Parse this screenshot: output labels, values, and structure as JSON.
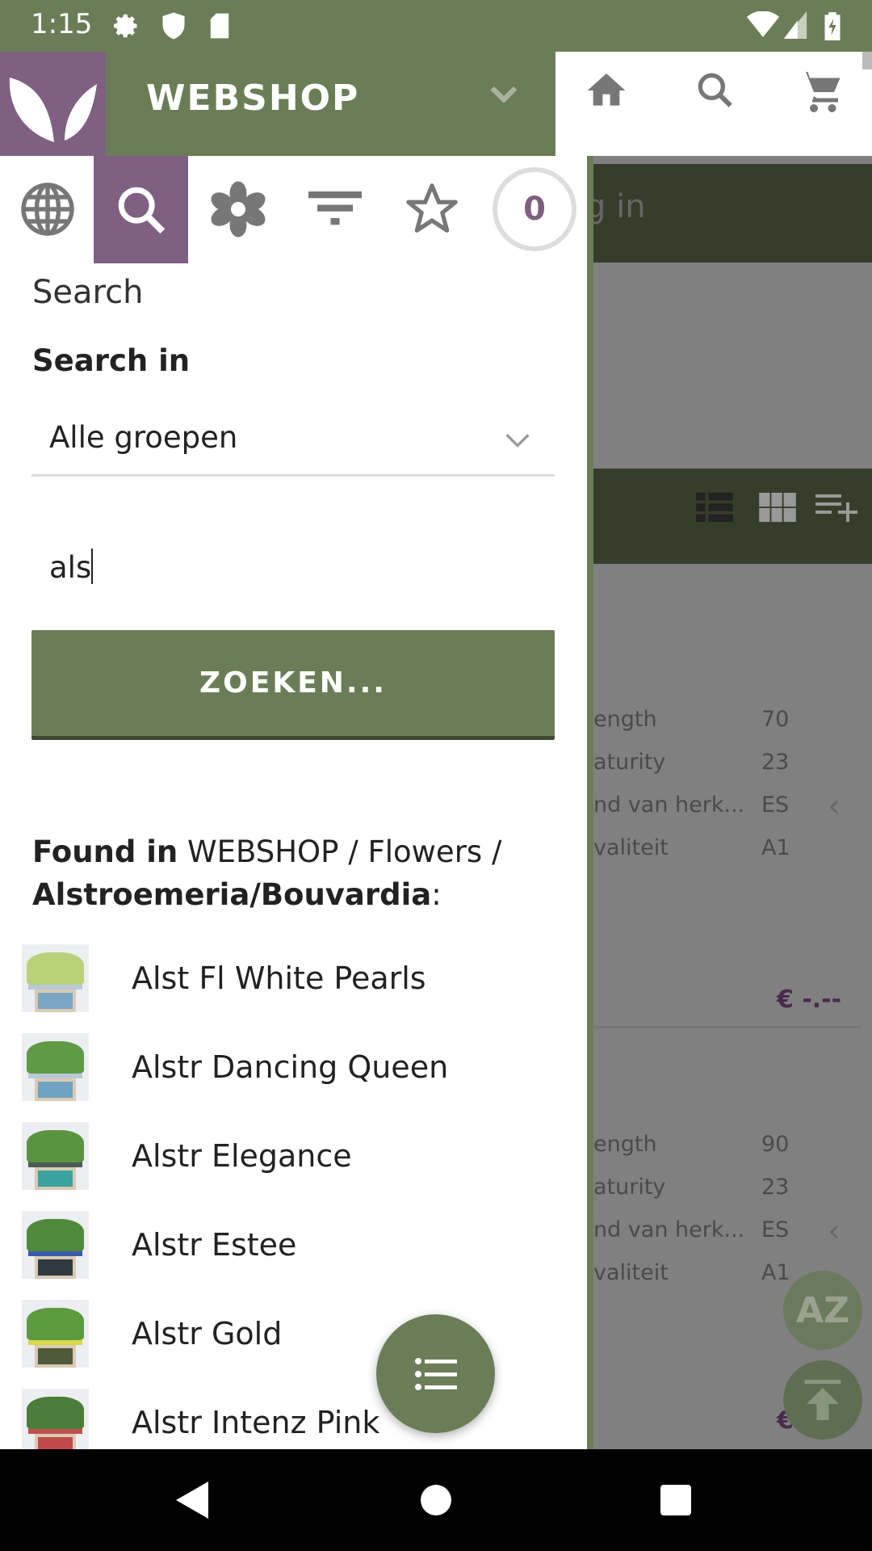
{
  "status_bar": {
    "time": "1:15",
    "icons": [
      "gear-icon",
      "shield-icon",
      "sd-card-icon",
      "wifi-icon",
      "signal-icon",
      "battery-charging-icon"
    ]
  },
  "header": {
    "title": "WEBSHOP",
    "icons": [
      "leaf-logo",
      "chevron-down-icon",
      "home-icon",
      "search-icon",
      "cart-icon"
    ]
  },
  "colors": {
    "brand_green": "#6b7d57",
    "brand_purple": "#7f5f82",
    "dark_bar": "#363d2b"
  },
  "drawer": {
    "tabs": [
      {
        "icon": "globe-icon"
      },
      {
        "icon": "search-icon",
        "active": true
      },
      {
        "icon": "flower-icon"
      },
      {
        "icon": "filter-icon"
      },
      {
        "icon": "star-icon"
      },
      {
        "icon": "counter-badge",
        "count": "0"
      }
    ],
    "section_title": "Search",
    "search_in_label": "Search in",
    "group_select": "Alle groepen",
    "search_value": "als",
    "search_button": "ZOEKEN...",
    "found_prefix": "Found in",
    "found_path": " WEBSHOP / Flowers / ",
    "found_group": "Alstroemeria/Bouvardia",
    "found_suffix": ":",
    "results": [
      {
        "name": "Alst Fl White Pearls",
        "flower": "#b9d27a",
        "wrap": "#b8c9d8",
        "box": "#7aa7c4"
      },
      {
        "name": "Alstr Dancing Queen",
        "flower": "#5f9a45",
        "wrap": "#b9cad6",
        "box": "#6fa3c2"
      },
      {
        "name": "Alstr Elegance",
        "flower": "#5a9440",
        "wrap": "#4f5a55",
        "box": "#3aa3a0"
      },
      {
        "name": "Alstr Estee",
        "flower": "#4f8a3c",
        "wrap": "#3d5aa8",
        "box": "#2f3a40"
      },
      {
        "name": "Alstr Gold",
        "flower": "#5c9a3e",
        "wrap": "#d8d64a",
        "box": "#4f5a3a"
      },
      {
        "name": "Alstr Intenz Pink",
        "flower": "#4a7d3a",
        "wrap": "#c05050",
        "box": "#c04a4a"
      }
    ]
  },
  "background": {
    "search_hint": "g in",
    "toolbar_icons": [
      "list-view-icon",
      "grid-view-icon",
      "playlist-add-icon"
    ],
    "products": [
      {
        "rows": [
          [
            "ength",
            "70"
          ],
          [
            "aturity",
            "23"
          ],
          [
            "nd van herk...",
            "ES"
          ],
          [
            "valiteit",
            "A1"
          ]
        ],
        "price": "€ -.--"
      },
      {
        "rows": [
          [
            "ength",
            "90"
          ],
          [
            "aturity",
            "23"
          ],
          [
            "nd van herk...",
            "ES"
          ],
          [
            "valiteit",
            "A1"
          ]
        ],
        "price": "€ -.--"
      }
    ],
    "sort_button": "AZ"
  }
}
